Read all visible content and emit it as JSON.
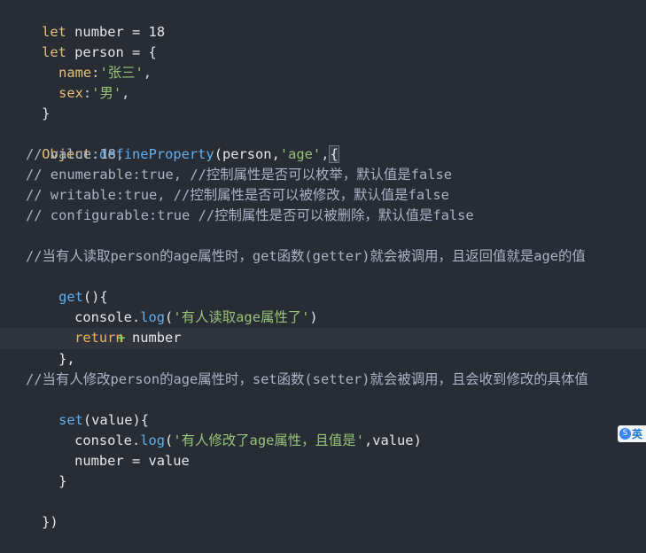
{
  "editor": {
    "code": [
      {
        "parts": [
          "let",
          " number = 18"
        ]
      },
      {
        "parts": [
          "let",
          " person = {"
        ]
      },
      {
        "parts": [
          "name",
          ":",
          "'张三'",
          ","
        ]
      },
      {
        "parts": [
          "sex",
          ":",
          "'男'",
          ","
        ]
      },
      {
        "parts": [
          "}"
        ]
      },
      {
        "parts": [
          ""
        ]
      },
      {
        "parts": [
          "Object",
          ".",
          "defineProperty",
          "(person,",
          "'age'",
          ",",
          "{"
        ]
      },
      {
        "parts": [
          "// value:18,"
        ]
      },
      {
        "parts": [
          "// enumerable:true, //控制属性是否可以枚举，默认值是false"
        ]
      },
      {
        "parts": [
          "// writable:true, //控制属性是否可以被修改，默认值是false"
        ]
      },
      {
        "parts": [
          "// configurable:true //控制属性是否可以被删除，默认值是false"
        ]
      },
      {
        "parts": [
          ""
        ]
      },
      {
        "parts": [
          "//当有人读取person的age属性时，get函数(getter)就会被调用，且返回值就是age的值"
        ]
      },
      {
        "parts": [
          "get",
          "(){"
        ]
      },
      {
        "parts": [
          "console",
          ".",
          "log",
          "(",
          "'有人读取age属性了'",
          ")"
        ]
      },
      {
        "parts": [
          "return",
          " number"
        ]
      },
      {
        "parts": [
          "},"
        ]
      },
      {
        "parts": [
          ""
        ]
      },
      {
        "parts": [
          "//当有人修改person的age属性时，set函数(setter)就会被调用，且会收到修改的具体值"
        ]
      },
      {
        "parts": [
          "set",
          "(value){"
        ]
      },
      {
        "parts": [
          "console",
          ".",
          "log",
          "(",
          "'有人修改了age属性，且值是'",
          ",value)"
        ]
      },
      {
        "parts": [
          "number",
          " = value"
        ]
      },
      {
        "parts": [
          "}"
        ]
      },
      {
        "parts": [
          ""
        ]
      },
      {
        "parts": [
          "})"
        ]
      }
    ],
    "gutter_marker": "+",
    "ime_badge": {
      "logo": "S",
      "label": "英"
    }
  }
}
